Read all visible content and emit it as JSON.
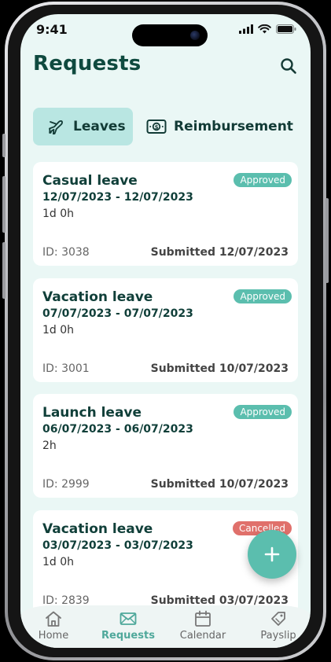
{
  "status_bar": {
    "time": "9:41"
  },
  "header": {
    "title": "Requests"
  },
  "tabs": [
    {
      "label": "Leaves",
      "active": true,
      "icon": "airplane-icon"
    },
    {
      "label": "Reimbursement",
      "active": false,
      "icon": "banknote-icon"
    }
  ],
  "requests": [
    {
      "type": "Casual leave",
      "dates": "12/07/2023 - 12/07/2023",
      "duration": "1d 0h",
      "id": "ID: 3038",
      "submitted": "Submitted 12/07/2023",
      "status": "Approved"
    },
    {
      "type": "Vacation leave",
      "dates": "07/07/2023 - 07/07/2023",
      "duration": "1d 0h",
      "id": "ID: 3001",
      "submitted": "Submitted 10/07/2023",
      "status": "Approved"
    },
    {
      "type": "Launch leave",
      "dates": "06/07/2023 - 06/07/2023",
      "duration": "2h",
      "id": "ID: 2999",
      "submitted": "Submitted 10/07/2023",
      "status": "Approved"
    },
    {
      "type": "Vacation leave",
      "dates": "03/07/2023 - 03/07/2023",
      "duration": "1d 0h",
      "id": "ID: 2839",
      "submitted": "Submitted 03/07/2023",
      "status": "Cancelled"
    }
  ],
  "bottom_nav": [
    {
      "label": "Home",
      "icon": "home-icon",
      "active": false
    },
    {
      "label": "Requests",
      "icon": "envelope-icon",
      "active": true
    },
    {
      "label": "Calendar",
      "icon": "calendar-icon",
      "active": false
    },
    {
      "label": "Payslip",
      "icon": "tag-icon",
      "active": false
    }
  ],
  "colors": {
    "brand_dark": "#0f4a3f",
    "accent": "#5bbeae",
    "approved": "#5bbeae",
    "cancelled": "#e0706b",
    "tab_active_bg": "#b9e6e2",
    "screen_bg": "#eaf7f5"
  }
}
